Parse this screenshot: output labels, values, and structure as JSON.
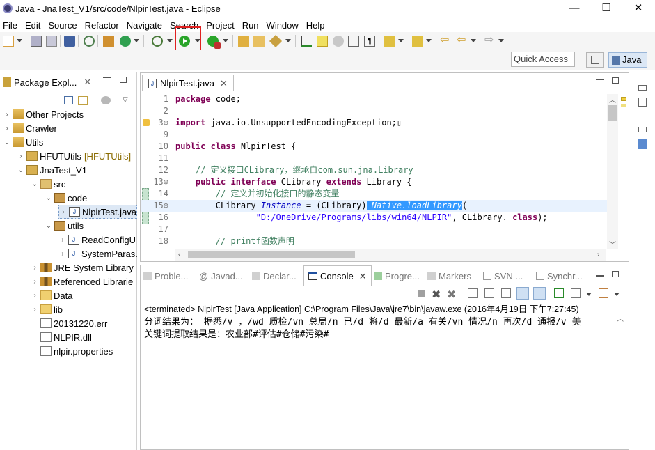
{
  "window": {
    "title": "Java - JnaTest_V1/src/code/NlpirTest.java - Eclipse",
    "controls": {
      "minimize": "—",
      "maximize": "☐",
      "close": "✕"
    }
  },
  "menu": [
    "File",
    "Edit",
    "Source",
    "Refactor",
    "Navigate",
    "Search",
    "Project",
    "Run",
    "Window",
    "Help"
  ],
  "perspective": {
    "quick_access_placeholder": "Quick Access",
    "java_label": "Java"
  },
  "package_explorer": {
    "tab_label": "Package Expl...",
    "tree": [
      {
        "label": "Other Projects",
        "twisty": "›"
      },
      {
        "label": "Crawler",
        "twisty": "›"
      },
      {
        "label": "Utils",
        "twisty": "⌄"
      },
      {
        "label": "HFUTUtils",
        "suffix": "[HFUTUtils]",
        "twisty": "›"
      },
      {
        "label": "JnaTest_V1",
        "twisty": "⌄"
      },
      {
        "label": "src",
        "twisty": "⌄"
      },
      {
        "label": "code",
        "twisty": "⌄"
      },
      {
        "label": "NlpirTest.java",
        "twisty": "›"
      },
      {
        "label": "utils",
        "twisty": "⌄"
      },
      {
        "label": "ReadConfigU",
        "twisty": "›"
      },
      {
        "label": "SystemParas.",
        "twisty": "›"
      },
      {
        "label": "JRE System Library",
        "twisty": "›"
      },
      {
        "label": "Referenced Librarie",
        "twisty": "›"
      },
      {
        "label": "Data",
        "twisty": "›"
      },
      {
        "label": "lib",
        "twisty": "›"
      },
      {
        "label": "20131220.err",
        "twisty": ""
      },
      {
        "label": "NLPIR.dll",
        "twisty": ""
      },
      {
        "label": "nlpir.properties",
        "twisty": ""
      }
    ]
  },
  "editor": {
    "tab_label": "NlpirTest.java",
    "lines": [
      {
        "num": "1",
        "parts": [
          [
            "kw",
            "package"
          ],
          [
            "",
            "code;"
          ]
        ]
      },
      {
        "num": "2",
        "parts": []
      },
      {
        "num": "3⊕",
        "parts": [
          [
            "kw",
            "import"
          ],
          [
            "",
            "java.io.UnsupportedEncodingException;▯"
          ]
        ]
      },
      {
        "num": "9",
        "parts": []
      },
      {
        "num": "10",
        "parts": [
          [
            "kw",
            "public class"
          ],
          [
            "",
            "NlpirTest {"
          ]
        ]
      },
      {
        "num": "11",
        "parts": []
      },
      {
        "num": "12",
        "parts": [
          [
            "",
            "    "
          ],
          [
            "cm",
            "// 定义接口CLibrary，继承自com.sun.jna.Library"
          ]
        ]
      },
      {
        "num": "13⊖",
        "parts": [
          [
            "",
            "    "
          ],
          [
            "kw",
            "public interface"
          ],
          [
            "",
            "CLibrary"
          ],
          [
            "kw",
            "extends"
          ],
          [
            "",
            "Library {"
          ]
        ]
      },
      {
        "num": "14",
        "parts": [
          [
            "",
            "        "
          ],
          [
            "cm",
            "// 定义并初始化接口的静态变量"
          ]
        ]
      },
      {
        "num": "15⊖",
        "parts": [
          [
            "",
            "        CLibrary"
          ],
          [
            "fld",
            "Instance"
          ],
          [
            "",
            "= (CLibrary)"
          ],
          [
            "sel",
            "Native.loadLibrary"
          ],
          [
            "",
            "("
          ]
        ]
      },
      {
        "num": "16",
        "parts": [
          [
            "",
            "                "
          ],
          [
            "str",
            "\"D:/OneDrive/Programs/libs/win64/NLPIR\""
          ],
          [
            "",
            ", CLibrary."
          ],
          [
            "kw",
            "class"
          ],
          [
            "",
            ");"
          ]
        ]
      },
      {
        "num": "17",
        "parts": []
      },
      {
        "num": "18",
        "parts": [
          [
            "",
            "        "
          ],
          [
            "cm",
            "// printf函数声明"
          ]
        ]
      }
    ]
  },
  "bottom": {
    "tabs": [
      "Proble...",
      "Javad...",
      "Declar...",
      "Console",
      "Progre...",
      "Markers",
      "SVN ...",
      "Synchr..."
    ],
    "terminated": "<terminated> NlpirTest [Java Application] C:\\Program Files\\Java\\jre7\\bin\\javaw.exe (2016年4月19日 下午7:27:45)",
    "output": [
      "分词结果为： 据悉/v ，/wd 质检/vn 总局/n 已/d 将/d 最新/a 有关/vn 情况/n 再次/d 通报/v 美",
      "关键词提取结果是：农业部#评估#仓储#污染#"
    ]
  },
  "colors": {
    "run_highlight": "#e02020",
    "selection": "#3399ff",
    "keyword": "#7f0055",
    "comment": "#3f7f5f",
    "string": "#2a00ff"
  }
}
